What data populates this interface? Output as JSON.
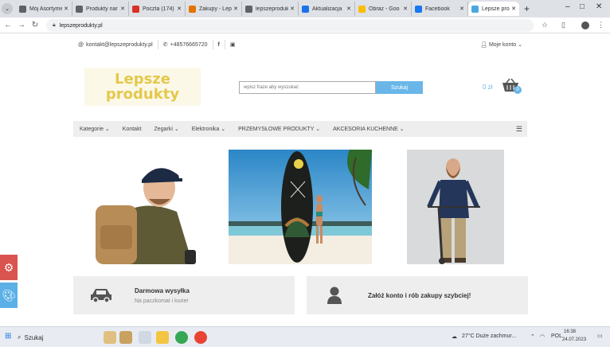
{
  "browser": {
    "tabs": [
      {
        "label": "Mój Asortyment",
        "color": "#5f6368"
      },
      {
        "label": "Produkty nar",
        "color": "#5f6368"
      },
      {
        "label": "Poczta (174)",
        "color": "#d93025"
      },
      {
        "label": "Zakupy - Lepsz",
        "color": "#e37400"
      },
      {
        "label": "lepszeprodukty",
        "color": "#5f6368"
      },
      {
        "label": "Aktualizacja",
        "color": "#1a73e8"
      },
      {
        "label": "Obraz - Goo",
        "color": "#fbbc04"
      },
      {
        "label": "Facebook",
        "color": "#1877f2"
      },
      {
        "label": "Lepsze produ",
        "color": "#4aa8e0",
        "active": true
      }
    ],
    "url": "lepszeprodukty.pl"
  },
  "site": {
    "topbar": {
      "email": "kontakt@lepszeprodukty.pl",
      "phone": "+48576665720",
      "account": "Moje konto"
    },
    "logo": {
      "line1": "Lepsze",
      "line2": "produkty"
    },
    "search": {
      "placeholder": "wpisz fraze aby wyszukać",
      "button": "Szukaj"
    },
    "cart": {
      "total": "0 zł",
      "count": "0"
    },
    "nav": [
      "Kategorie",
      "Kontakt",
      "Zegarki",
      "Elektronika",
      "PRZEMYSŁOWE PRODUKTY",
      "AKCESORIA KUCHENNE"
    ],
    "features": [
      {
        "title": "Darmowa wysyłka",
        "subtitle": "Na paczkomat i kurier"
      },
      {
        "title": "Załóż konto i rób zakupy szybciej!",
        "subtitle": ""
      }
    ]
  },
  "taskbar": {
    "search_label": "Szukaj",
    "weather": "27°C  Duże zachmur...",
    "lang": "POL",
    "time": "16:38",
    "date": "24.07.2023"
  },
  "colors": {
    "accent": "#6ab6e8",
    "logo": "#e4c84c",
    "side_red": "#d9534f",
    "side_blue": "#5bb0e6"
  }
}
